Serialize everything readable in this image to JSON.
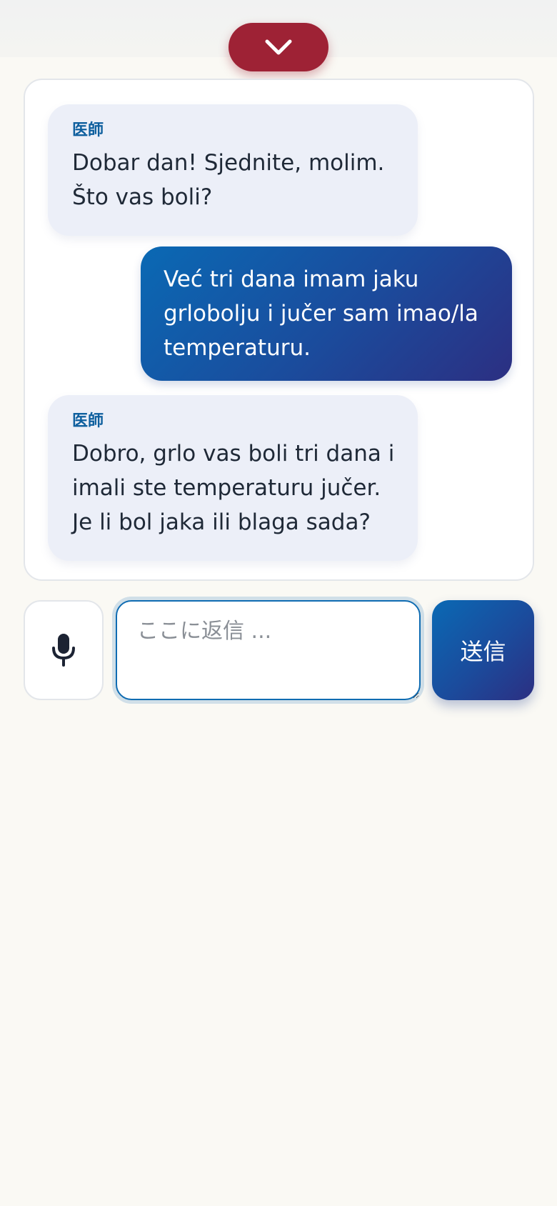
{
  "header": {
    "collapse_icon": "chevron-down-icon",
    "accent_color": "#9e2235"
  },
  "chat": {
    "messages": [
      {
        "role": "doctor",
        "speaker": "医師",
        "text": "Dobar dan! Sjednite, molim. Što vas boli?"
      },
      {
        "role": "patient",
        "text": "Već tri dana imam jaku grlobolju i jučer sam imao/la temperaturu."
      },
      {
        "role": "doctor",
        "speaker": "医師",
        "text": "Dobro, grlo vas boli tri dana i imali ste temperaturu jučer. Je li bol jaka ili blaga sada?"
      }
    ]
  },
  "composer": {
    "mic_icon": "microphone-icon",
    "placeholder": "ここに返信 ...",
    "value": "",
    "send_label": "送信",
    "send_color": "#1b4b9c"
  }
}
